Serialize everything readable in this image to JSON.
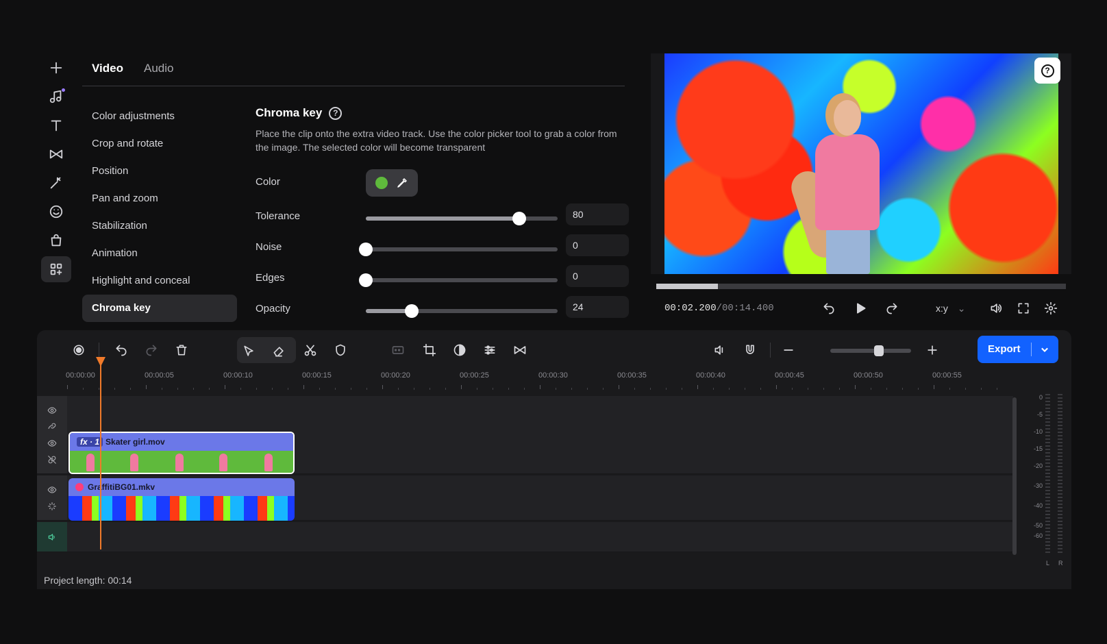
{
  "sidebar": {
    "icons": [
      "plus-icon",
      "music-icon",
      "text-icon",
      "transition-icon",
      "magic-wand-icon",
      "sticker-icon",
      "shopping-bag-icon",
      "more-tools-icon"
    ]
  },
  "tabs": [
    {
      "label": "Video",
      "active": true
    },
    {
      "label": "Audio",
      "active": false
    }
  ],
  "menu": [
    "Color adjustments",
    "Crop and rotate",
    "Position",
    "Pan and zoom",
    "Stabilization",
    "Animation",
    "Highlight and conceal",
    "Chroma key"
  ],
  "menu_active_index": 7,
  "chroma": {
    "title": "Chroma key",
    "description": "Place the clip onto the extra video track. Use the color picker tool to grab a color from the image. The selected color will become transparent",
    "color_label": "Color",
    "color_value": "#5fba3c",
    "sliders": [
      {
        "label": "Tolerance",
        "value": "80",
        "fraction": 0.8
      },
      {
        "label": "Noise",
        "value": "0",
        "fraction": 0
      },
      {
        "label": "Edges",
        "value": "0",
        "fraction": 0
      },
      {
        "label": "Opacity",
        "value": "24",
        "fraction": 0.24
      }
    ]
  },
  "player": {
    "time_current": "00:02.200",
    "time_total": "/00:14.400",
    "progress_fraction": 0.15,
    "aspect": "x:y"
  },
  "toolbar": {
    "export_label": "Export"
  },
  "zoom_fraction": 0.6,
  "ruler": {
    "labels": [
      "00:00:00",
      "00:00:05",
      "00:00:10",
      "00:00:15",
      "00:00:20",
      "00:00:25",
      "00:00:30",
      "00:00:35",
      "00:00:40",
      "00:00:45",
      "00:00:50",
      "00:00:55"
    ]
  },
  "clips": [
    {
      "fx": "fx · 1",
      "name": "Skater girl.mov"
    },
    {
      "name": "GraffitiBG01.mkv"
    }
  ],
  "meter": {
    "labels": [
      "0",
      "-5",
      "-10",
      "-15",
      "-20",
      "-30",
      "-40",
      "-50",
      "-60"
    ],
    "left": "L",
    "right": "R"
  },
  "status": {
    "project_length": "Project length: 00:14"
  },
  "colors": {
    "accent": "#1262ff",
    "playhead": "#f07a2a",
    "clip": "#6b78e8",
    "chroma_green": "#5fba3c"
  }
}
